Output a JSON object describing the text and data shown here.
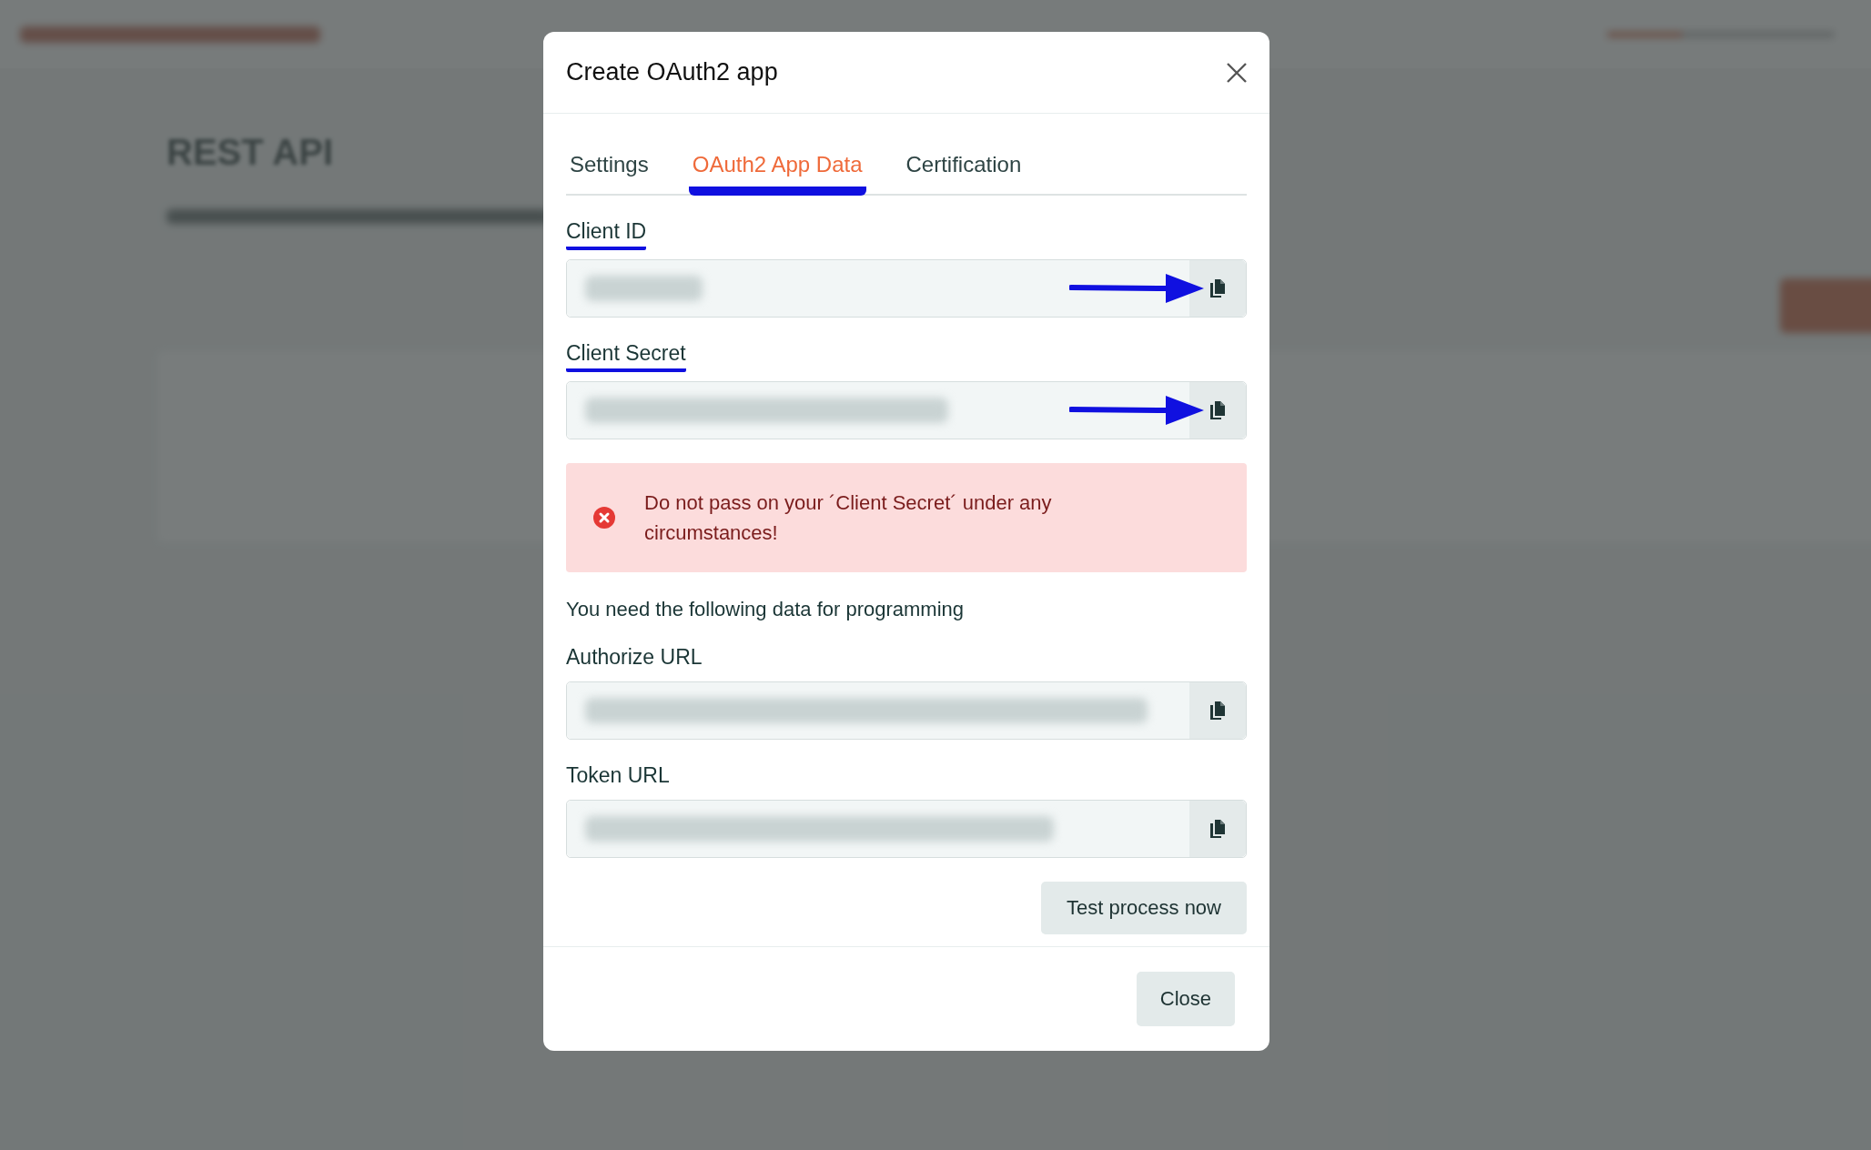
{
  "background": {
    "page_title": "REST API",
    "progress": {
      "level": 0.33
    }
  },
  "dialog": {
    "title": "Create OAuth2 app",
    "tabs": [
      {
        "label": "Settings",
        "selected": false
      },
      {
        "label": "OAuth2 App Data",
        "selected": true
      },
      {
        "label": "Certification",
        "selected": false
      }
    ],
    "credentials": [
      {
        "label": "Client ID",
        "highlighted": true,
        "arrow": true
      },
      {
        "label": "Client Secret",
        "highlighted": true,
        "arrow": true
      }
    ],
    "alert": {
      "kind": "error",
      "message": "Do not pass on your ´Client Secret´ under any circumstances!"
    },
    "intro": "You need the following data for programming",
    "endpoints": [
      {
        "label": "Authorize URL",
        "highlighted": false,
        "arrow": false
      },
      {
        "label": "Token URL",
        "highlighted": false,
        "arrow": false
      }
    ],
    "test_button": "Test process now",
    "close_button": "Close"
  }
}
